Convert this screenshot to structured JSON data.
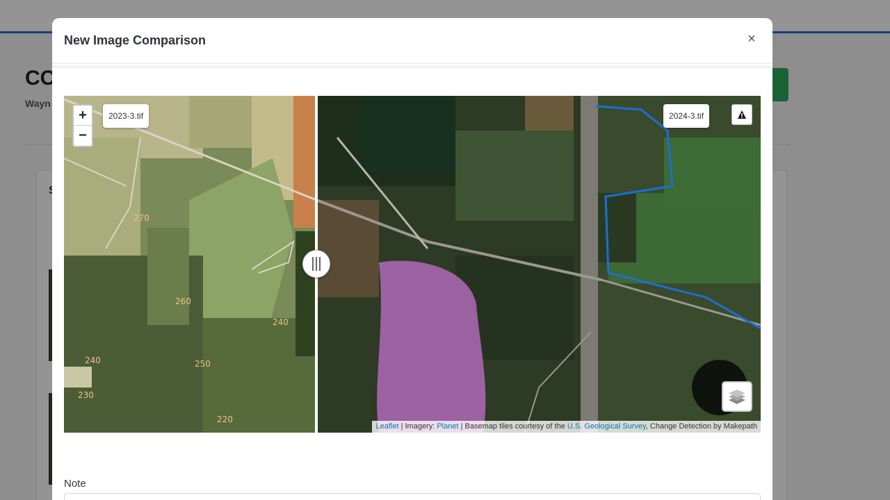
{
  "background": {
    "title": "CC",
    "subtitle": "Wayn",
    "card_letter": "S"
  },
  "modal": {
    "title": "New Image Comparison",
    "close_label": "×"
  },
  "map": {
    "zoom_in_label": "+",
    "zoom_out_label": "−",
    "left_image_label": "2023-3.tif",
    "right_image_label": "2024-3.tif",
    "warning_icon": "warning-icon",
    "layers_icon": "layers-icon",
    "contour_labels": [
      "270",
      "260",
      "240",
      "240",
      "250",
      "230",
      "220"
    ],
    "attribution": {
      "leaflet": "Leaflet",
      "sep1": " | Imagery: ",
      "planet": "Planet",
      "sep2": " | Basemap tiles courtesy of the ",
      "usgs": "U.S. Geological Survey",
      "tail": ", Change Detection by Makepath"
    }
  },
  "form": {
    "note_label": "Note",
    "note_value": ""
  },
  "colors": {
    "accent": "#1f6fd0",
    "boundary": "#1a6fd6",
    "change_highlight": "#b06ab8",
    "link": "#0078a8"
  }
}
